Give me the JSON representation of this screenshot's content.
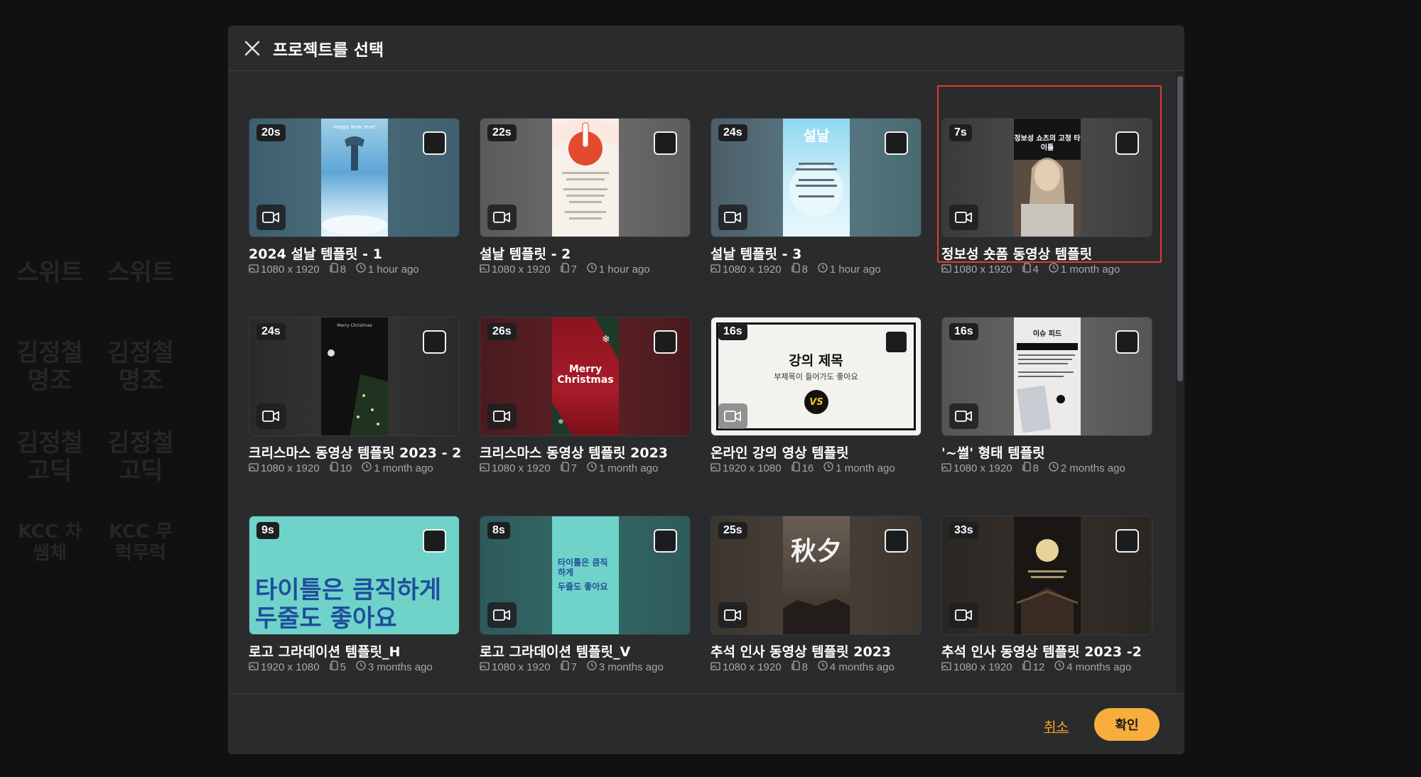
{
  "background": {
    "items": [
      "스위트",
      "스위트",
      "김정철 명조",
      "김정철 명조",
      "김정철 고딕",
      "김정철 고딕",
      "KCC 차쌤체",
      "KCC 무럭무럭"
    ]
  },
  "modal": {
    "title": "프로젝트를 선택",
    "close_icon": "close-icon",
    "cancel_label": "취소",
    "ok_label": "확인",
    "accent": "#f7ae3c",
    "selected_outline_color": "#e23b2d"
  },
  "projects": [
    {
      "duration": "20s",
      "title": "2024 설날 템플릿 - 1",
      "size": "1080 x 1920",
      "pages": "8",
      "time": "1 hour ago",
      "poster_text": "Happy New Year!"
    },
    {
      "duration": "22s",
      "title": "설날 템플릿 - 2",
      "size": "1080 x 1920",
      "pages": "7",
      "time": "1 hour ago",
      "poster_text": ""
    },
    {
      "duration": "24s",
      "title": "설날 템플릿 - 3",
      "size": "1080 x 1920",
      "pages": "8",
      "time": "1 hour ago",
      "poster_text": "설날"
    },
    {
      "duration": "7s",
      "title": "정보성 숏폼 동영상 템플릿",
      "size": "1080 x 1920",
      "pages": "4",
      "time": "1 month ago",
      "poster_text": "정보성 쇼츠의 고정 타이틀"
    },
    {
      "duration": "24s",
      "title": "크리스마스 동영상 템플릿 2023 - 2",
      "size": "1080 x 1920",
      "pages": "10",
      "time": "1 month ago",
      "poster_text": "Merry Christmas"
    },
    {
      "duration": "26s",
      "title": "크리스마스 동영상 템플릿 2023",
      "size": "1080 x 1920",
      "pages": "7",
      "time": "1 month ago",
      "poster_text": "Merry Christmas"
    },
    {
      "duration": "16s",
      "title": "온라인 강의 영상 템플릿",
      "size": "1920 x 1080",
      "pages": "16",
      "time": "1 month ago",
      "poster_text": "강의 제목",
      "poster_sub": "부제목이 들어가도 좋아요",
      "poster_badge": "VS"
    },
    {
      "duration": "16s",
      "title": "'~썰' 형태 템플릿",
      "size": "1080 x 1920",
      "pages": "8",
      "time": "2 months ago",
      "poster_text": "이슈 피드"
    },
    {
      "duration": "9s",
      "title": "로고 그라데이션 템플릿_H",
      "size": "1920 x 1080",
      "pages": "5",
      "time": "3 months ago",
      "poster_text": "타이틀은 큼직하게",
      "poster_sub": "두줄도 좋아요"
    },
    {
      "duration": "8s",
      "title": "로고 그라데이션 템플릿_V",
      "size": "1080 x 1920",
      "pages": "7",
      "time": "3 months ago",
      "poster_text": "타이틀은 큼직하게",
      "poster_sub": "두줄도 좋아요"
    },
    {
      "duration": "25s",
      "title": "추석 인사 동영상 템플릿 2023",
      "size": "1080 x 1920",
      "pages": "8",
      "time": "4 months ago",
      "poster_text": "秋夕"
    },
    {
      "duration": "33s",
      "title": "추석 인사 동영상 템플릿 2023 -2",
      "size": "1080 x 1920",
      "pages": "12",
      "time": "4 months ago",
      "poster_text": ""
    }
  ]
}
